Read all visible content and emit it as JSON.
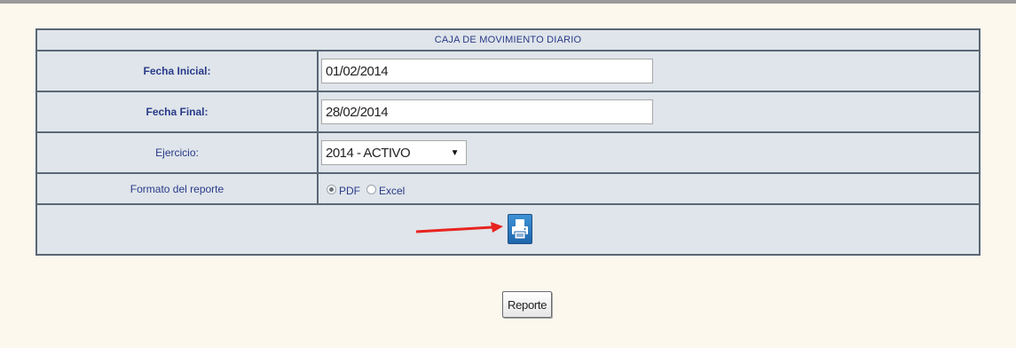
{
  "form": {
    "title": "CAJA DE MOVIMIENTO DIARIO",
    "fecha_inicial": {
      "label": "Fecha Inicial:",
      "value": "01/02/2014"
    },
    "fecha_final": {
      "label": "Fecha Final:",
      "value": "28/02/2014"
    },
    "ejercicio": {
      "label": "Ejercicio:",
      "selected": "2014 - ACTIVO"
    },
    "formato": {
      "label": "Formato del reporte",
      "options": [
        {
          "label": "PDF",
          "checked": true
        },
        {
          "label": "Excel",
          "checked": false
        }
      ]
    }
  },
  "actions": {
    "print_icon": "printer-icon",
    "report_button": "Reporte"
  },
  "colors": {
    "page_background": "#fdf8ee",
    "cell_background": "#dfe5ea",
    "label_text": "#2a3a8a",
    "print_button": "#2a7ac2",
    "annotation_arrow": "#e8231f"
  }
}
